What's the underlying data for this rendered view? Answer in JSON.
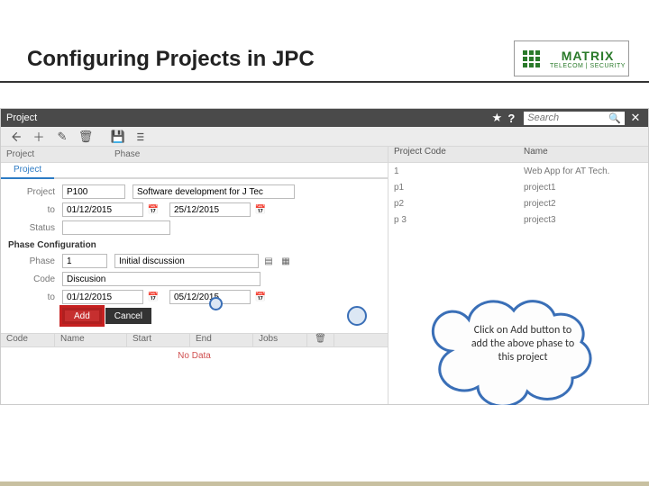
{
  "slide": {
    "title": "Configuring Projects in JPC"
  },
  "logo": {
    "brand": "MATRIX",
    "tagline": "TELECOM | SECURITY"
  },
  "app_header": {
    "title": "Project"
  },
  "search": {
    "placeholder": "Search"
  },
  "left_header": {
    "col1": "Project",
    "col2": "Phase"
  },
  "tabs": {
    "project": "Project"
  },
  "form": {
    "project_label": "Project",
    "project_code": "P100",
    "project_name": "Software development for J Tec",
    "to_label": "to",
    "from_date": "01/12/2015",
    "to_date": "25/12/2015",
    "status_label": "Status",
    "status_value": "",
    "section": "Phase Configuration",
    "phase_label": "Phase",
    "phase_num": "1",
    "phase_name": "Initial discussion",
    "code_label": "Code",
    "code_value": "Discusion",
    "pto_label": "to",
    "pfrom_date": "01/12/2015",
    "pto_date": "05/12/2015",
    "add_btn": "Add",
    "cancel_btn": "Cancel"
  },
  "cols": {
    "code": "Code",
    "name": "Name",
    "start": "Start",
    "end": "End",
    "jobs": "Jobs"
  },
  "nodata": "No Data",
  "right_header": {
    "col1": "Project Code",
    "col2": "Name"
  },
  "projects": [
    {
      "code": "1",
      "name": "Web App for AT Tech."
    },
    {
      "code": "p1",
      "name": "project1"
    },
    {
      "code": "p2",
      "name": "project2"
    },
    {
      "code": "p 3",
      "name": "project3"
    }
  ],
  "callout": "Click on Add button to add the above phase to this project"
}
